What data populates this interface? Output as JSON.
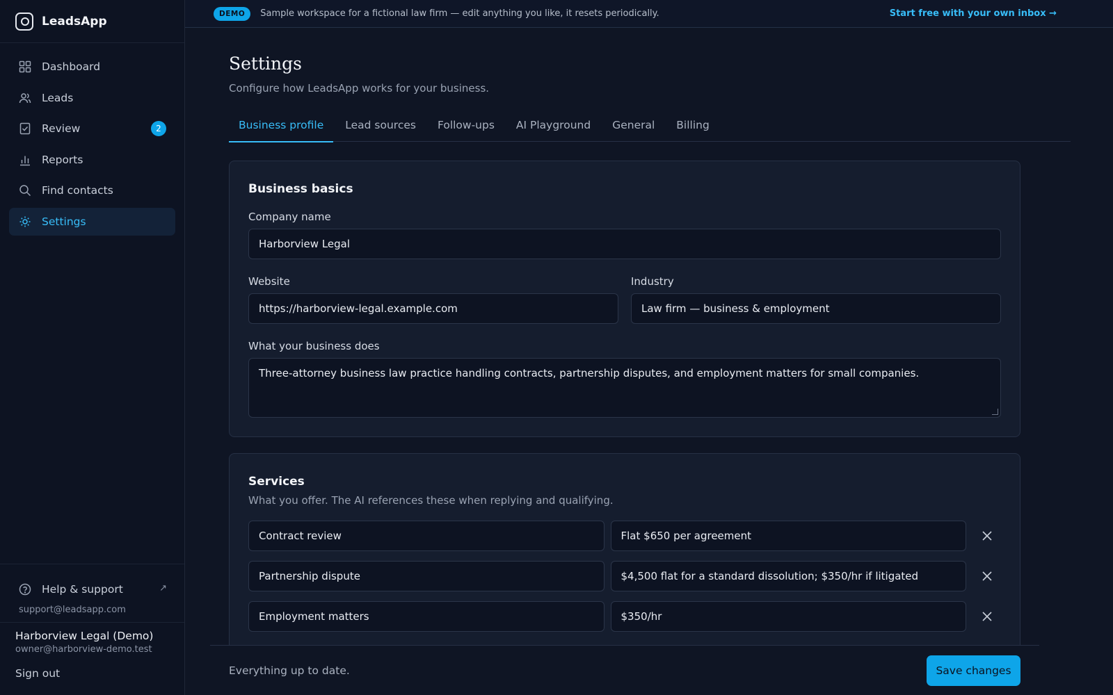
{
  "app": {
    "name": "LeadsApp"
  },
  "sidebar": {
    "items": [
      {
        "label": "Dashboard",
        "icon": "grid-icon"
      },
      {
        "label": "Leads",
        "icon": "users-icon"
      },
      {
        "label": "Review",
        "icon": "checklist-icon",
        "badge": "2"
      },
      {
        "label": "Reports",
        "icon": "bar-chart-icon"
      },
      {
        "label": "Find contacts",
        "icon": "search-icon"
      },
      {
        "label": "Settings",
        "icon": "gear-icon",
        "active": true
      }
    ],
    "help_label": "Help & support",
    "support_email": "support@leadsapp.com",
    "user_name": "Harborview Legal (Demo)",
    "user_email": "owner@harborview-demo.test",
    "signout_label": "Sign out"
  },
  "banner": {
    "pill": "DEMO",
    "text": "Sample workspace for a fictional law firm — edit anything you like, it resets periodically.",
    "link": "Start free with your own inbox →"
  },
  "page": {
    "title": "Settings",
    "subtitle": "Configure how LeadsApp works for your business."
  },
  "tabs": [
    "Business profile",
    "Lead sources",
    "Follow-ups",
    "AI Playground",
    "General",
    "Billing"
  ],
  "business_basics": {
    "title": "Business basics",
    "company_label": "Company name",
    "company_value": "Harborview Legal",
    "website_label": "Website",
    "website_value": "https://harborview-legal.example.com",
    "industry_label": "Industry",
    "industry_value": "Law firm — business & employment",
    "description_label": "What your business does",
    "description_value": "Three-attorney business law practice handling contracts, partnership disputes, and employment matters for small companies."
  },
  "services": {
    "title": "Services",
    "subtitle": "What you offer. The AI references these when replying and qualifying.",
    "rows": [
      {
        "name": "Contract review",
        "price": "Flat $650 per agreement"
      },
      {
        "name": "Partnership dispute",
        "price": "$4,500 flat for a standard dissolution; $350/hr if litigated"
      },
      {
        "name": "Employment matters",
        "price": "$350/hr"
      }
    ]
  },
  "footer": {
    "status": "Everything up to date.",
    "save_label": "Save changes"
  },
  "colors": {
    "accent": "#0ea5e9",
    "accent_text": "#38bdf8",
    "background": "#0f1524",
    "card": "#151d2e"
  }
}
